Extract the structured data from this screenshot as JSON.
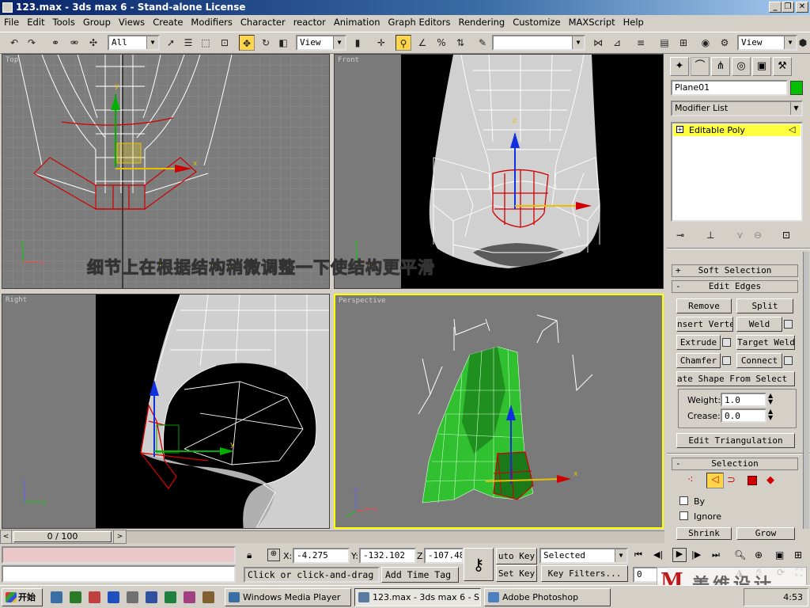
{
  "window": {
    "title": "123.max - 3ds max 6 - Stand-alone License"
  },
  "menu": [
    "File",
    "Edit",
    "Tools",
    "Group",
    "Views",
    "Create",
    "Modifiers",
    "Character",
    "reactor",
    "Animation",
    "Graph Editors",
    "Rendering",
    "Customize",
    "MAXScript",
    "Help"
  ],
  "toolbar": {
    "selection_filter": "All",
    "ref_coord": "View",
    "named_selection": "",
    "view_right": "View"
  },
  "viewports": {
    "top": "Top",
    "front": "Front",
    "right": "Right",
    "perspective": "Perspective"
  },
  "caption": "细节上在根据结构稍微调整一下使结构更平滑",
  "panel": {
    "object_name": "Plane01",
    "modifier_list": "Modifier List",
    "stack_item": "Editable Poly",
    "soft_selection": "Soft Selection",
    "edit_edges": "Edit Edges",
    "remove": "Remove",
    "split": "Split",
    "insert_vertex": "nsert Verte",
    "weld": "Weld",
    "extrude": "Extrude",
    "target_weld": "Target Weld",
    "chamfer": "Chamfer",
    "connect": "Connect",
    "create_shape": "ate Shape From Select",
    "weight_label": "Weight:",
    "weight_value": "1.0",
    "crease_label": "Crease:",
    "crease_value": "0.0",
    "edit_triangulation": "Edit Triangulation",
    "selection": "Selection",
    "by": "By",
    "ignore": "Ignore",
    "shrink": "Shrink",
    "grow": "Grow"
  },
  "timeline": {
    "frame": "0 / 100"
  },
  "status": {
    "x_label": "X:",
    "x": "-4.275",
    "y_label": "Y:",
    "y": "-132.102",
    "z_label": "Z:",
    "z": "-107.48",
    "prompt": "Click or click-and-drag",
    "add_time_tag": "Add Time Tag",
    "auto_key": "uto Key",
    "set_key": "Set Key",
    "selected": "Selected",
    "key_filters": "Key Filters...",
    "frame_field": "0"
  },
  "taskbar": {
    "start": "开始",
    "tasks": [
      "Windows Media Player",
      "123.max - 3ds max 6 - S...",
      "Adobe Photoshop"
    ],
    "clock": "4:53",
    "watermark": "美维设计"
  },
  "colors": {
    "title_dark": "#0a246a",
    "title_light": "#a6caf0",
    "active_viewport": "#ffff00",
    "caption": "#ffff00",
    "object_color": "#00c000",
    "stack_highlight": "#ffff40"
  }
}
